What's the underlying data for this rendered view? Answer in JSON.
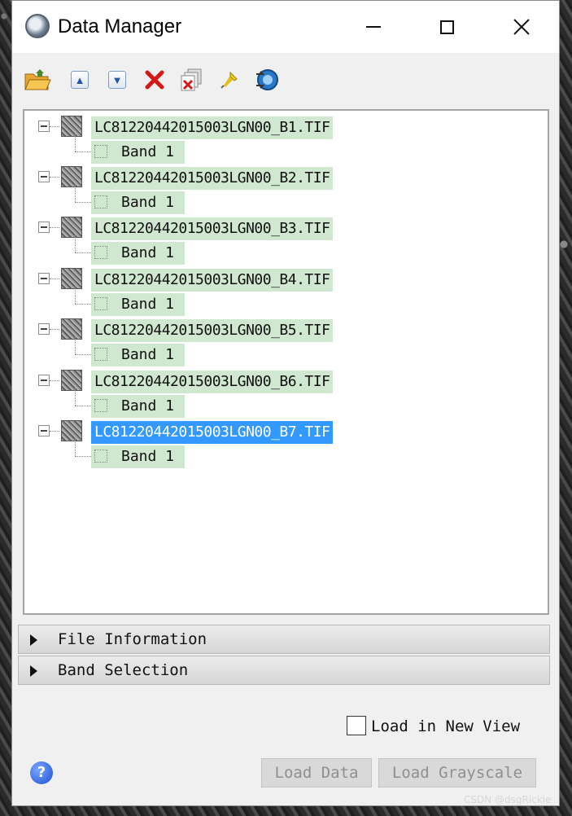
{
  "window": {
    "title": "Data Manager"
  },
  "toolbar": {
    "buttons": [
      "open-icon",
      "move-up-icon",
      "move-down-icon",
      "remove-icon",
      "close-all-icon",
      "pin-icon",
      "sync-view-icon"
    ]
  },
  "tree": {
    "files": [
      {
        "name": "LC81220442015003LGN00_B1.TIF",
        "band": "Band 1",
        "selected": false
      },
      {
        "name": "LC81220442015003LGN00_B2.TIF",
        "band": "Band 1",
        "selected": false
      },
      {
        "name": "LC81220442015003LGN00_B3.TIF",
        "band": "Band 1",
        "selected": false
      },
      {
        "name": "LC81220442015003LGN00_B4.TIF",
        "band": "Band 1",
        "selected": false
      },
      {
        "name": "LC81220442015003LGN00_B5.TIF",
        "band": "Band 1",
        "selected": false
      },
      {
        "name": "LC81220442015003LGN00_B6.TIF",
        "band": "Band 1",
        "selected": false
      },
      {
        "name": "LC81220442015003LGN00_B7.TIF",
        "band": "Band 1",
        "selected": true
      }
    ]
  },
  "sections": {
    "file_info": "File Information",
    "band_selection": "Band Selection"
  },
  "options": {
    "load_new_view": "Load in New View"
  },
  "buttons": {
    "load_data": "Load Data",
    "load_grayscale": "Load Grayscale"
  },
  "help": "?",
  "watermark": "CSDN @dsgRickie",
  "colors": {
    "selection": "#3399ff",
    "item_highlight": "#cfe8cf"
  }
}
